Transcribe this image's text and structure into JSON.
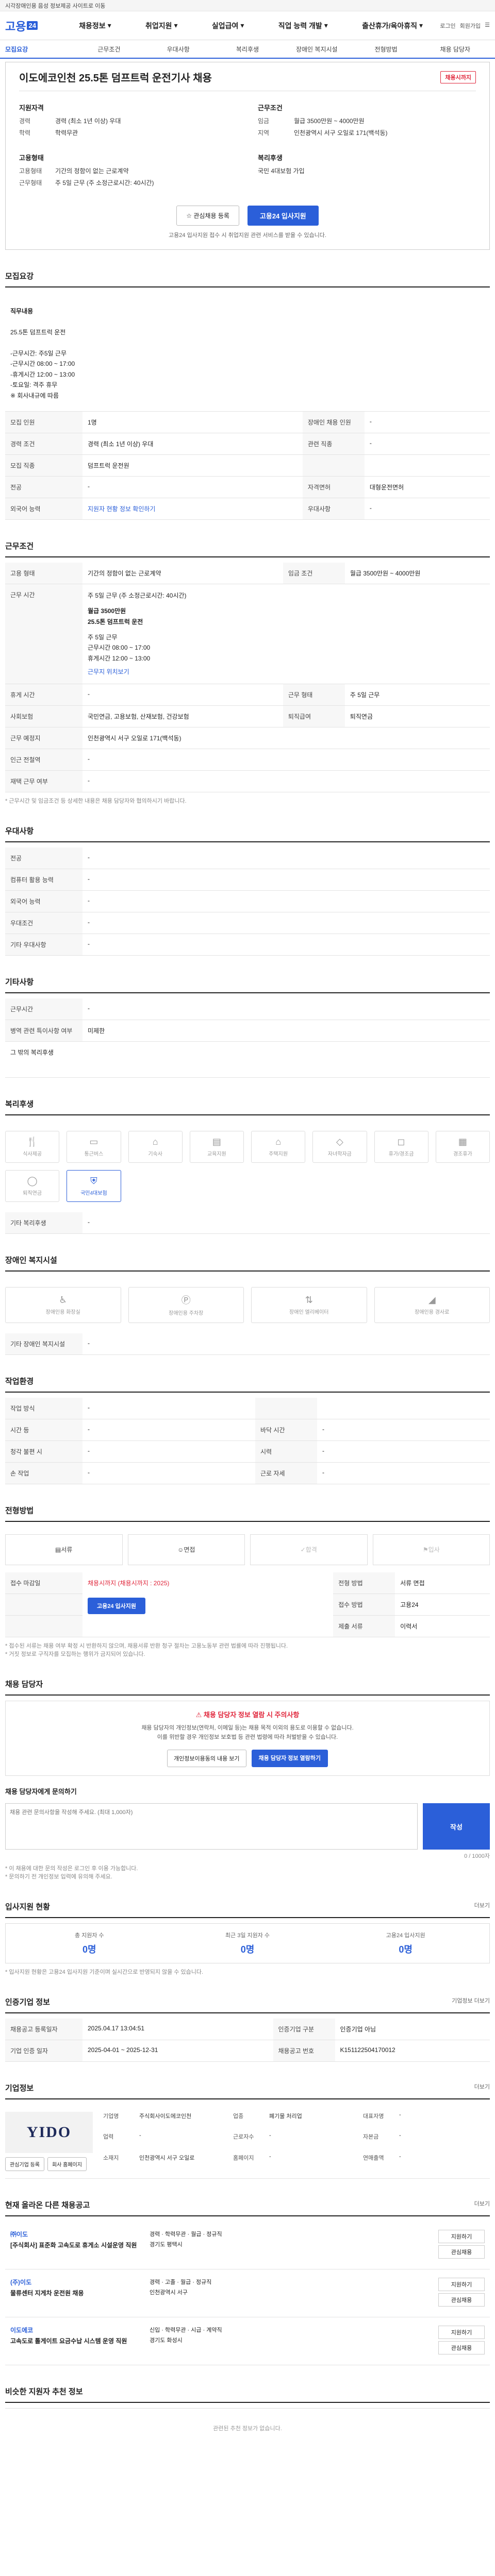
{
  "topbar": {
    "notice": "시각장애인용 음성 정보제공 사이트로 이동"
  },
  "header": {
    "logo": "고용",
    "logo_mark": "24",
    "nav": [
      "채용정보",
      "취업지원",
      "실업급여",
      "직업 능력 개발",
      "출산휴가/육아휴직"
    ],
    "login": "로그인",
    "join": "회원가입"
  },
  "subnav": [
    "모집요강",
    "근무조건",
    "우대사항",
    "복리후생",
    "장애인 복지시설",
    "전형방법",
    "채용 담당자"
  ],
  "job": {
    "title": "이도에코인천 25.5톤 덤프트럭 운전기사 채용",
    "badge": "채용시까지",
    "summary_left_title": "지원자격",
    "rows_left": [
      [
        "경력",
        "경력 (최소 1년 이상) 우대"
      ],
      [
        "학력",
        "학력무관"
      ]
    ],
    "summary_right_title": "근무조건",
    "rows_right": [
      [
        "임금",
        "월급 3500만원 ~ 4000만원"
      ],
      [
        "지역",
        "인천광역시 서구 오일로 171(백석동)"
      ]
    ],
    "summary_left_title2": "고용형태",
    "rows_left2": [
      [
        "고용형태",
        "기간의 정함이 없는 근로계약"
      ],
      [
        "근무형태",
        "주 5일 근무 (주 소정근로시간: 40시간)"
      ]
    ],
    "summary_right_title2": "복리후생",
    "rows_right2": [
      [
        "",
        "국민 4대보험 가입"
      ]
    ],
    "btn_scrap": "관심채용 등록",
    "btn_apply": "고용24 입사지원",
    "note": "고용24 입사지원 접수 시 취업지원 관련 서비스를 받을 수 있습니다."
  },
  "s1": {
    "title": "모집요강",
    "duty_title": "직무내용",
    "duty": "25.5톤 덤프트럭 운전\n\n-근무시간: 주5일 근무\n-근무시간 08:00 ~ 17:00\n-휴게시간 12:00 ~ 13:00\n-토요일: 격주 휴무\n※ 회사내규에 따름",
    "rows": [
      [
        "모집 인원",
        "1명",
        "장애인 채용 인원",
        "-"
      ],
      [
        "경력 조건",
        "경력 (최소 1년 이상) 우대",
        "관련 직종",
        "-"
      ],
      [
        "모집 직종",
        "덤프트럭 운전원",
        "",
        ""
      ],
      [
        "전공",
        "-",
        "자격면허",
        "대형운전면허"
      ],
      [
        "외국어 능력",
        "-",
        "우대사항",
        "-"
      ]
    ],
    "map_note": "지원자 현황 정보 확인하기"
  },
  "s2": {
    "title": "근무조건",
    "rows": [
      [
        "고용 형태",
        "기간의 정함이 없는 근로계약",
        "임금 조건",
        "월급 3500만원 ~ 4000만원"
      ],
      [
        "근무 시간",
        "주 5일 근무 (주 소정근로시간: 40시간)",
        "",
        ""
      ],
      [
        "휴게 시간",
        "-",
        "근무 형태",
        "주 5일 근무"
      ],
      [
        "사회보험",
        "국민연금, 고용보험, 산재보험, 건강보험",
        "퇴직급여",
        "퇴직연금"
      ],
      [
        "근무 예정지",
        "인천광역시 서구 오일로 171(백석동)",
        "",
        ""
      ],
      [
        "인근 전철역",
        "-",
        "",
        ""
      ],
      [
        "재택 근무 여부",
        "-",
        "",
        ""
      ]
    ],
    "work_detail": "주 5일 근무\n근무시간 08:00 ~ 17:00\n휴게시간 12:00 ~ 13:00",
    "salary_detail": "월급 3500만원\n25.5톤 덤프트럭 운전",
    "link": "근무지 위치보기",
    "footnote": "* 근무시간 및 임금조건 등 상세한 내용은 채용 담당자와 협의하시기 바랍니다."
  },
  "s3": {
    "title": "우대사항",
    "rows": [
      [
        "전공",
        "-"
      ],
      [
        "컴퓨터 활용 능력",
        "-"
      ],
      [
        "외국어 능력",
        "-"
      ],
      [
        "우대조건",
        "-"
      ],
      [
        "기타 우대사항",
        "-"
      ]
    ]
  },
  "s4": {
    "title": "기타사항",
    "rows": [
      [
        "근무시간",
        "-"
      ],
      [
        "병역 관련 특이사항 여부",
        "미제한"
      ]
    ],
    "extra": "그 밖의 복리후생"
  },
  "s5": {
    "title": "복리후생",
    "items": [
      "식사제공",
      "통근버스",
      "기숙사",
      "교육지원",
      "주택지원",
      "자녀학자금",
      "휴가/경조금",
      "경조휴가",
      "퇴직연금",
      "국민4대보험"
    ],
    "other_t": "기타 복리후생",
    "other": "-"
  },
  "s6": {
    "title": "장애인 복지시설",
    "items": [
      "장애인용 화장실",
      "장애인용 주차장",
      "장애인 엘리베이터",
      "장애인용 경사로"
    ],
    "other_t": "기타 장애인 복지시설",
    "other": "-"
  },
  "s7": {
    "title": "작업환경",
    "rows": [
      [
        "작업 방식",
        "-",
        "",
        ""
      ],
      [
        "시간 등",
        "-",
        "바닥 시간",
        "-"
      ],
      [
        "청각 불편 시",
        "-",
        "시력",
        "-"
      ],
      [
        "손 작업",
        "-",
        "근로 자세",
        "-"
      ]
    ]
  },
  "s8": {
    "title": "전형방법",
    "steps": [
      "서류",
      "면접",
      "합격",
      "입사"
    ],
    "rows": [
      [
        "접수 마감일",
        "채용시까지 (채용시까지 : 2025)",
        "전형 방법",
        "서류 면접"
      ],
      [
        "",
        "",
        "접수 방법",
        "고용24"
      ],
      [
        "",
        "",
        "제출 서류",
        "이력서"
      ]
    ],
    "apply": "고용24 입사지원",
    "notes": "* 접수된 서류는 채용 여부 확정 시 반환하지 않으며, 채용서류 반환 청구 절차는 고용노동부 관련 법률에 따라 진행됩니다.\n* 거짓 정보로 구직자를 모집하는 행위가 금지되어 있습니다."
  },
  "s9": {
    "title": "채용 담당자",
    "warn_t": "채용 담당자 정보 열람 시 주의사항",
    "warn": "채용 담당자의 개인정보(연락처, 이메일 등)는 채용 목적 이외의 용도로 이용할 수 없습니다.\n이를 위반할 경우 개인정보 보호법 등 관련 법령에 따라 처벌받을 수 있습니다.",
    "btn1": "개인정보이용동의 내용 보기",
    "btn2": "채용 담당자 정보 열람하기",
    "inq_t": "채용 담당자에게 문의하기",
    "inq_ph": "채용 관련 문의사항을 작성해 주세요. (최대 1,000자)",
    "inq_btn": "작성",
    "inq_count": "0 / 1000자",
    "inq_notes": "* 이 채용에 대한 문의 작성은 로그인 후 이용 가능합니다.\n* 문의하기 전 개인정보 입력에 유의해 주세요."
  },
  "s10": {
    "title": "입사지원 현황",
    "more": "더보기",
    "stats": [
      [
        "총 지원자 수",
        "0명"
      ],
      [
        "최근 3일 지원자 수",
        "0명"
      ],
      [
        "고용24 입사지원",
        "0명"
      ]
    ],
    "note": "* 입사지원 현황은 고용24 입사지원 기준이며 실시간으로 반영되지 않을 수 있습니다."
  },
  "s11": {
    "title": "인증기업 정보",
    "more": "기업정보 더보기",
    "rows": [
      [
        "채용공고 등록일자",
        "2025.04.17 13:04:51",
        "인증기업 구분",
        "인증기업 아님"
      ],
      [
        "기업 인증 일자",
        "2025-04-01 ~ 2025-12-31",
        "채용공고 번호",
        "K151122504170012"
      ]
    ]
  },
  "s12": {
    "title": "기업정보",
    "logo": "YIDO",
    "more": "더보기",
    "info": [
      [
        "기업명",
        "주식회사이도에코인천"
      ],
      [
        "업종",
        "폐기물 처리업"
      ],
      [
        "대표자명",
        "-"
      ],
      [
        "업력",
        "-"
      ],
      [
        "근로자수",
        "-"
      ],
      [
        "자본금",
        "-"
      ],
      [
        "소재지",
        "인천광역시 서구 오일로"
      ],
      [
        "홈페이지",
        "-"
      ],
      [
        "연매출액",
        "-"
      ]
    ],
    "btn1": "관심기업 등록",
    "btn2": "회사 홈페이지"
  },
  "s13": {
    "title": "현재 올라온 다른 채용공고",
    "more": "더보기",
    "items": [
      {
        "co": "㈜이도",
        "title": "[주식회사] 표준화 고속도로 휴게소 시설운영 직원",
        "meta": "경력 · 학력무관 · 월급 · 정규직",
        "loc": "경기도 평택시",
        "pills": [
          "지원하기",
          "관심채용"
        ]
      },
      {
        "co": "(주)이도",
        "title": "물류센터 지게차 운전원 채용",
        "meta": "경력 · 고졸 · 월급 · 정규직",
        "loc": "인천광역시 서구",
        "pills": [
          "지원하기",
          "관심채용"
        ]
      },
      {
        "co": "이도에코",
        "title": "고속도로 톨게이트 요금수납 시스템 운영 직원",
        "meta": "신입 · 학력무관 · 시급 · 계약직",
        "loc": "경기도 화성시",
        "pills": [
          "지원하기",
          "관심채용"
        ]
      }
    ]
  },
  "s14": {
    "title": "비슷한 지원자 추천 정보",
    "empty": "관련된 추천 정보가 없습니다."
  }
}
